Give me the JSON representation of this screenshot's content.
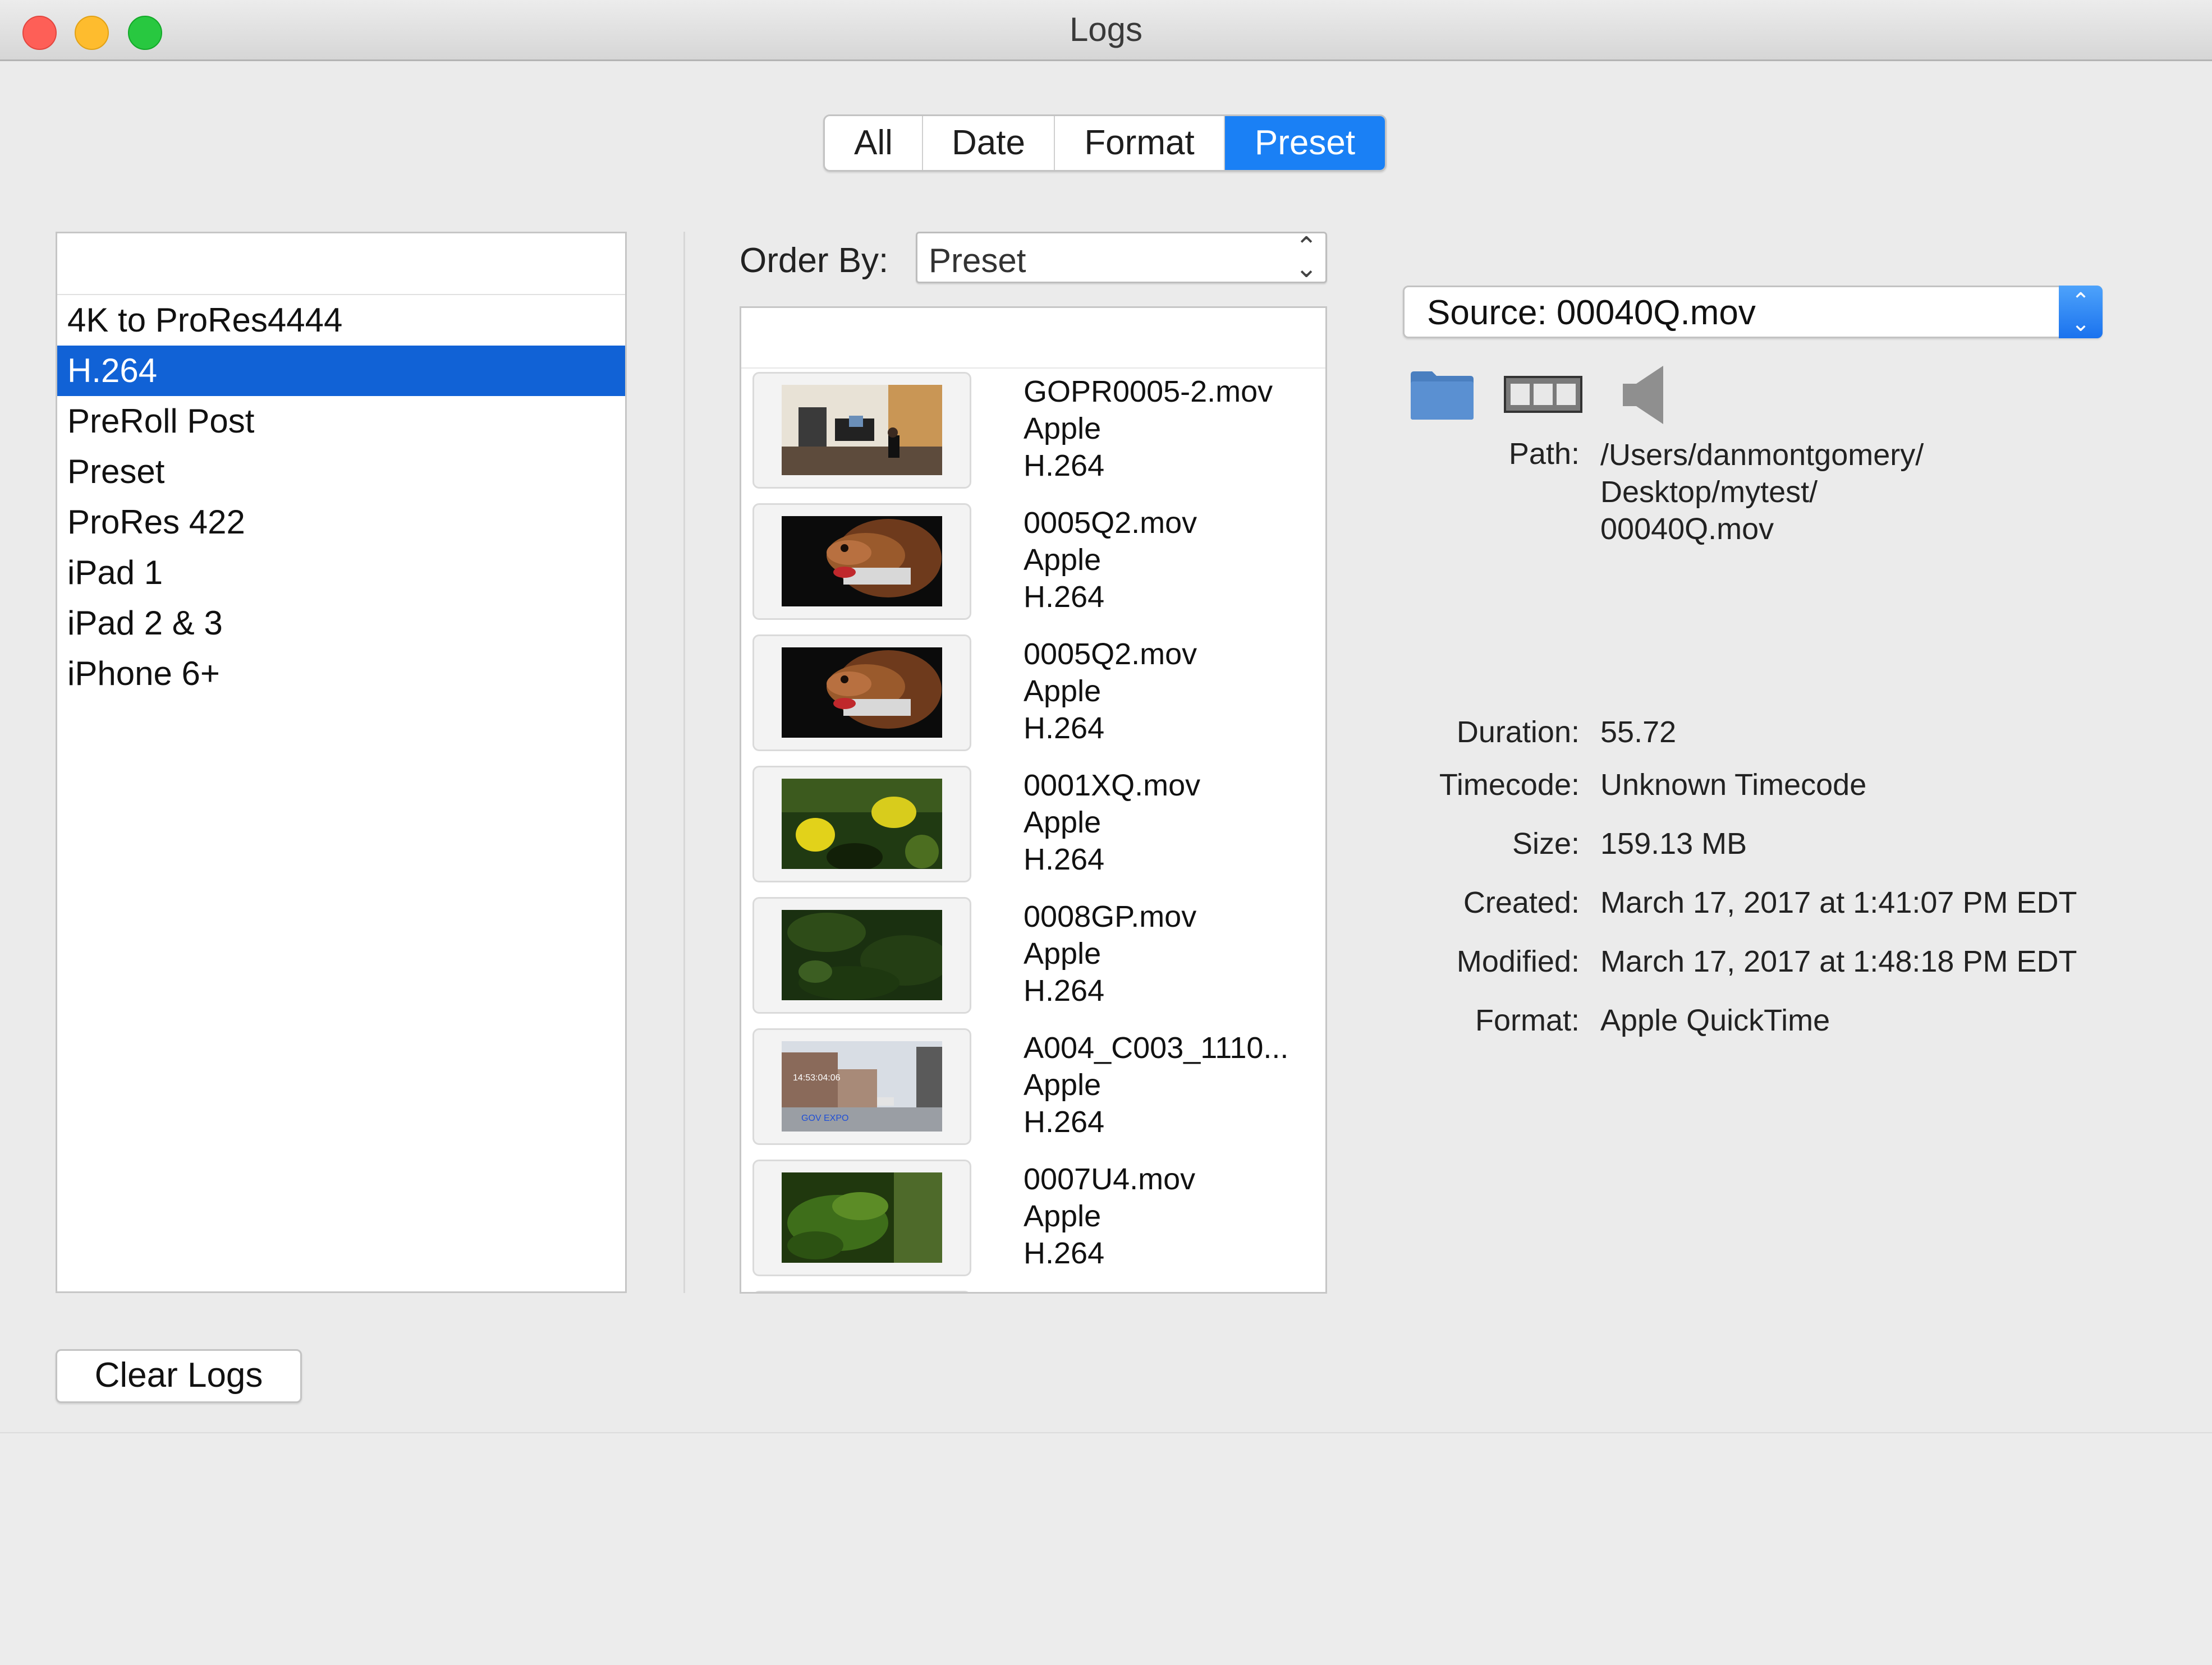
{
  "window": {
    "title": "Logs"
  },
  "tabs": [
    {
      "label": "All",
      "active": false
    },
    {
      "label": "Date",
      "active": false
    },
    {
      "label": "Format",
      "active": false
    },
    {
      "label": "Preset",
      "active": true
    }
  ],
  "presets": {
    "items": [
      "4K to ProRes4444",
      "H.264",
      "PreRoll Post",
      "Preset",
      "ProRes 422",
      "iPad 1",
      "iPad 2 & 3",
      "iPhone 6+"
    ],
    "selected": "H.264"
  },
  "order_by": {
    "label": "Order By:",
    "value": "Preset"
  },
  "files": [
    {
      "name": "GOPR0005-2.mov",
      "vendor": "Apple",
      "codec": "H.264",
      "thumb": "office-room"
    },
    {
      "name": "0005Q2.mov",
      "vendor": "Apple",
      "codec": "H.264",
      "thumb": "dog"
    },
    {
      "name": "0005Q2.mov",
      "vendor": "Apple",
      "codec": "H.264",
      "thumb": "dog"
    },
    {
      "name": "0001XQ.mov",
      "vendor": "Apple",
      "codec": "H.264",
      "thumb": "yellow-flowers"
    },
    {
      "name": "0008GP.mov",
      "vendor": "Apple",
      "codec": "H.264",
      "thumb": "green-foliage"
    },
    {
      "name": "A004_C003_1110...",
      "vendor": "Apple",
      "codec": "H.264",
      "thumb": "city-street"
    },
    {
      "name": "0007U4.mov",
      "vendor": "Apple",
      "codec": "H.264",
      "thumb": "fern"
    }
  ],
  "thumb_overlay": {
    "timecode": "14:53:04:06",
    "caption": "GOV EXPO"
  },
  "source": {
    "label": "Source: 00040Q.mov"
  },
  "details": {
    "path_label": "Path:",
    "path_lines": [
      "/Users/danmontgomery/",
      "Desktop/mytest/",
      "00040Q.mov"
    ],
    "rows": [
      {
        "label": "Duration:",
        "value": "55.72"
      },
      {
        "label": "Timecode:",
        "value": "Unknown Timecode"
      },
      {
        "label": "Size:",
        "value": "159.13 MB"
      },
      {
        "label": "Created:",
        "value": "March 17, 2017 at 1:41:07 PM EDT"
      },
      {
        "label": "Modified:",
        "value": "March 17, 2017 at 1:48:18 PM EDT"
      },
      {
        "label": "Format:",
        "value": "Apple QuickTime"
      }
    ]
  },
  "icons": [
    "folder-icon",
    "film-strip-icon",
    "speaker-icon"
  ],
  "buttons": {
    "clear_logs": "Clear Logs"
  },
  "colors": {
    "accent": "#1a80f5",
    "selection": "#1162d6"
  }
}
